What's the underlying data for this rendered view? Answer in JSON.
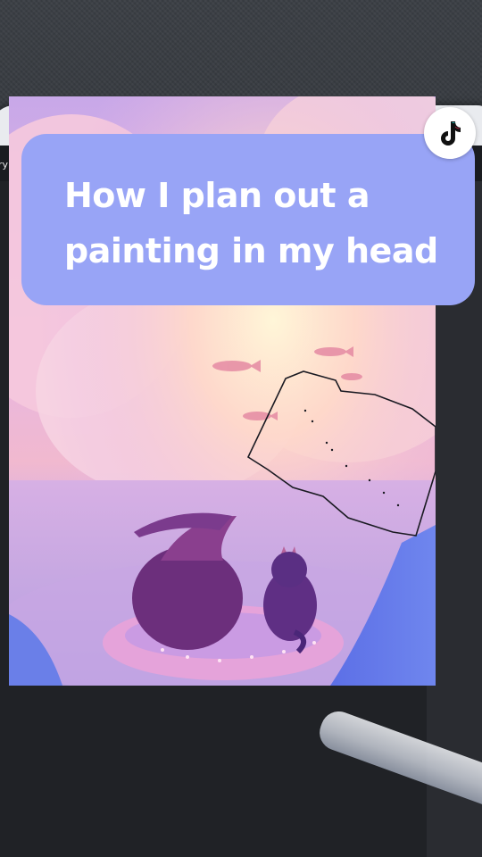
{
  "app": {
    "top_bar_label": "ry"
  },
  "overlay": {
    "title": "How I plan out a painting in my head"
  },
  "branding": {
    "logo_icon": "tiktok-logo-icon"
  },
  "colors": {
    "title_card": "#98a4f6",
    "title_text": "#ffffff",
    "toolbar": "#1a1c20"
  }
}
